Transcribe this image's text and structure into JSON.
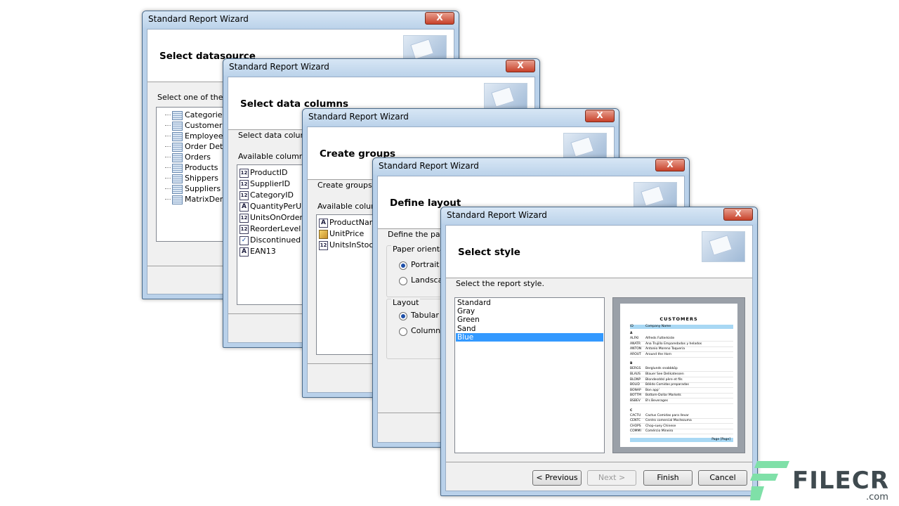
{
  "windows": [
    {
      "title": "Standard Report Wizard",
      "close": "X",
      "step": "Select datasource",
      "prompt": "Select one of the ava",
      "items": [
        "Categories",
        "Customers",
        "Employees",
        "Order Detail",
        "Orders",
        "Products",
        "Shippers",
        "Suppliers",
        "MatrixDemo"
      ]
    },
    {
      "title": "Standard Report Wizard",
      "close": "X",
      "step": "Select data columns",
      "prompt": "Select data columns",
      "available_label": "Available columns:",
      "items": [
        {
          "icon": "12",
          "label": "ProductID"
        },
        {
          "icon": "12",
          "label": "SupplierID"
        },
        {
          "icon": "12",
          "label": "CategoryID"
        },
        {
          "icon": "A",
          "label": "QuantityPerUnit"
        },
        {
          "icon": "12",
          "label": "UnitsOnOrder"
        },
        {
          "icon": "12",
          "label": "ReorderLevel"
        },
        {
          "icon": "check",
          "label": "Discontinued"
        },
        {
          "icon": "A",
          "label": "EAN13"
        }
      ]
    },
    {
      "title": "Standard Report Wizard",
      "close": "X",
      "step": "Create groups",
      "prompt": "Create groups (op",
      "available_label": "Available colum",
      "items": [
        {
          "icon": "A",
          "label": "ProductName"
        },
        {
          "icon": "money",
          "label": "UnitPrice"
        },
        {
          "icon": "12",
          "label": "UnitsInStock"
        }
      ]
    },
    {
      "title": "Standard Report Wizard",
      "close": "X",
      "step": "Define layout",
      "prompt": "Define the paper",
      "orientation_label": "Paper orientatio",
      "portrait": "Portrait",
      "landscape": "Landscape",
      "layout_label": "Layout",
      "tabular": "Tabular",
      "columnar": "Columnar"
    },
    {
      "title": "Standard Report Wizard",
      "close": "X",
      "step": "Select style",
      "prompt": "Select the report style.",
      "styles": [
        "Standard",
        "Gray",
        "Green",
        "Sand",
        "Blue"
      ],
      "selected_style": "Blue",
      "buttons": {
        "previous": "< Previous",
        "next": "Next >",
        "finish": "Finish",
        "cancel": "Cancel"
      }
    }
  ],
  "preview": {
    "title": "CUSTOMERS",
    "header": [
      "ID",
      "Company Name"
    ],
    "groups": [
      {
        "letter": "A",
        "rows": [
          [
            "ALFKI",
            "Alfreds Futterkiste"
          ],
          [
            "ANATR",
            "Ana Trujillo Emparedados y helados"
          ],
          [
            "ANTON",
            "Antonio Moreno Taqueria"
          ],
          [
            "AROUT",
            "Around the Horn"
          ]
        ]
      },
      {
        "letter": "B",
        "rows": [
          [
            "BERGS",
            "Berglunds snabbköp"
          ],
          [
            "BLAUS",
            "Blauer See Delikatessen"
          ],
          [
            "BLONP",
            "Blondesddsl père et fils"
          ],
          [
            "BOLID",
            "Bólido Comidas preparadas"
          ],
          [
            "BONAP",
            "Bon app'"
          ],
          [
            "BOTTM",
            "Bottom-Dollar Markets"
          ],
          [
            "BSBEV",
            "B's Beverages"
          ]
        ]
      },
      {
        "letter": "C",
        "rows": [
          [
            "CACTU",
            "Cactus Comidas para llevar"
          ],
          [
            "CENTC",
            "Centro comercial Moctezuma"
          ],
          [
            "CHOPS",
            "Chop-suey Chinese"
          ],
          [
            "COMMI",
            "Comércio Mineiro"
          ]
        ]
      }
    ],
    "footer": "Page [Page]",
    "accent": "#a8d8f4"
  },
  "logo": {
    "name": "FILECR",
    "domain": ".com",
    "mark_color": "#7fe0a8"
  }
}
